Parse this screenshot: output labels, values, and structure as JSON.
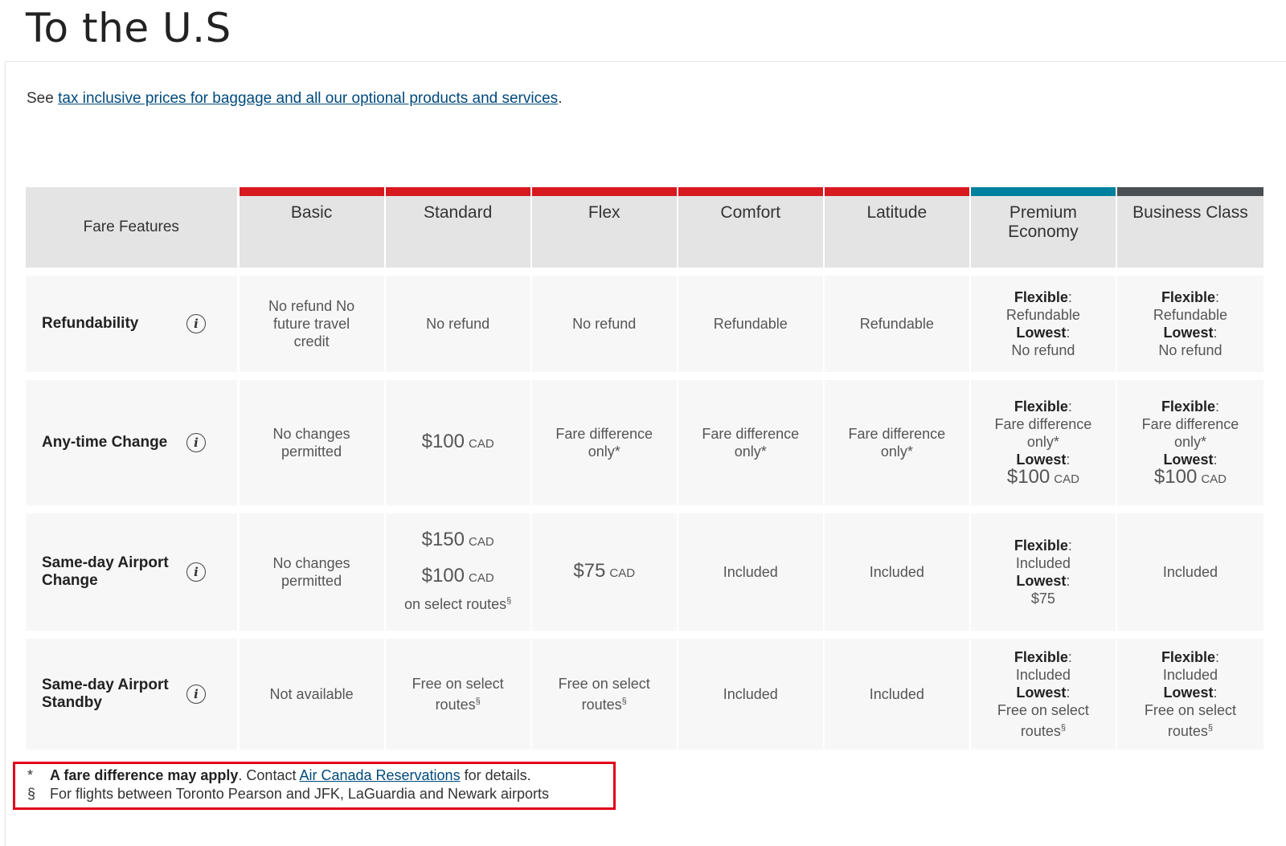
{
  "title": "To the U.S",
  "intro": {
    "prefix": "See ",
    "link_text": "tax inclusive prices for baggage and all our optional products and services",
    "suffix": "."
  },
  "table": {
    "feature_header": "Fare Features",
    "columns": [
      {
        "name": "Basic",
        "color": "#d71920"
      },
      {
        "name": "Standard",
        "color": "#d71920"
      },
      {
        "name": "Flex",
        "color": "#d71920"
      },
      {
        "name": "Comfort",
        "color": "#d71920"
      },
      {
        "name": "Latitude",
        "color": "#d71920"
      },
      {
        "name": "Premium Economy",
        "color": "#00819e"
      },
      {
        "name": "Business Class",
        "color": "#4a4f54"
      }
    ],
    "rows": {
      "refundability": {
        "label": "Refundability",
        "basic": "No refund No future travel credit",
        "standard": "No refund",
        "flex": "No refund",
        "comfort": "Refundable",
        "latitude": "Refundable",
        "premium": {
          "flex_label": "Flexible",
          "flex_value": "Refundable",
          "low_label": "Lowest",
          "low_value": "No refund"
        },
        "business": {
          "flex_label": "Flexible",
          "flex_value": "Refundable",
          "low_label": "Lowest",
          "low_value": "No refund"
        }
      },
      "anytime_change": {
        "label": "Any-time Change",
        "basic": "No changes permitted",
        "standard_price": "$100",
        "currency": "CAD",
        "flex": "Fare difference only*",
        "comfort": "Fare difference only*",
        "latitude": "Fare difference only*",
        "premium": {
          "flex_label": "Flexible",
          "flex_value": "Fare difference only*",
          "low_label": "Lowest",
          "low_price": "$100"
        },
        "business": {
          "flex_label": "Flexible",
          "flex_value": "Fare difference only*",
          "low_label": "Lowest",
          "low_price": "$100"
        }
      },
      "sameday_change": {
        "label": "Same-day Airport Change",
        "basic": "No changes permitted",
        "standard_price1": "$150",
        "standard_price2": "$100",
        "standard_note": "on select routes",
        "flex_price": "$75",
        "currency": "CAD",
        "comfort": "Included",
        "latitude": "Included",
        "premium": {
          "flex_label": "Flexible",
          "flex_value": "Included",
          "low_label": "Lowest",
          "low_value": "$75"
        },
        "business": "Included"
      },
      "sameday_standby": {
        "label": "Same-day Airport Standby",
        "basic": "Not available",
        "standard": "Free on select routes",
        "flex": "Free on select routes",
        "comfort": "Included",
        "latitude": "Included",
        "premium": {
          "flex_label": "Flexible",
          "flex_value": "Included",
          "low_label": "Lowest",
          "low_value": "Free on select routes"
        },
        "business": {
          "flex_label": "Flexible",
          "flex_value": "Included",
          "low_label": "Lowest",
          "low_value": "Free on select routes"
        }
      }
    },
    "info_icon_glyph": "i",
    "section_symbol": "§",
    "colon": ":"
  },
  "footnotes": {
    "star_symbol": "*",
    "star_bold": "A fare difference may apply",
    "star_mid": ". Contact ",
    "star_link": "Air Canada Reservations",
    "star_end": " for details.",
    "section_symbol": "§",
    "section_text": "For flights between Toronto Pearson and JFK, LaGuardia and Newark airports",
    "highlight_color": "#e0001b"
  }
}
